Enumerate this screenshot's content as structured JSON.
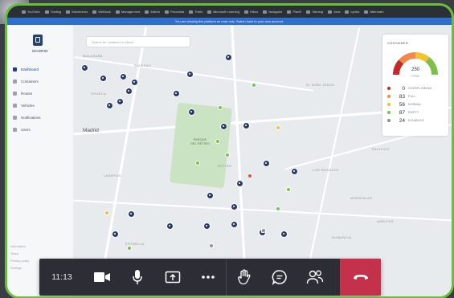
{
  "browser": {
    "tabs": [
      "YouTube",
      "Trading",
      "Waveforms",
      "WeBlock",
      "Management",
      "Airbnb",
      "Pavovista",
      "Trello",
      "Microsoft Learning",
      "Hibox",
      "Navigator",
      "PlanR",
      "Taiming",
      "Jobs",
      "Lydea",
      "Aftermath"
    ],
    "notice": "You are viewing this platform as read-only. Switch back to your own account."
  },
  "app": {
    "brand": "MADRID",
    "nav": [
      {
        "label": "Dashboard",
        "icon": "grid-icon"
      },
      {
        "label": "Containers",
        "icon": "container-icon"
      },
      {
        "label": "Routes",
        "icon": "route-icon"
      },
      {
        "label": "Vehicles",
        "icon": "truck-icon"
      },
      {
        "label": "Notifications",
        "icon": "bell-icon"
      },
      {
        "label": "Users",
        "icon": "users-icon"
      }
    ],
    "active_nav": 0,
    "footer": [
      "Information",
      "Terms",
      "Privacy policy",
      "Settings"
    ]
  },
  "map": {
    "search_placeholder": "Search for container or street",
    "labels": [
      {
        "text": "MALASAÑA",
        "big": false
      },
      {
        "text": "SALESAS",
        "big": false
      },
      {
        "text": "CHUECA",
        "big": false
      },
      {
        "text": "Madrid",
        "big": true
      },
      {
        "text": "RETIRO",
        "big": false
      },
      {
        "text": "LAVAPIES",
        "big": false
      },
      {
        "text": "ESTRELLA",
        "big": false
      },
      {
        "text": "MORATALAZ",
        "big": false
      },
      {
        "text": "ADELFAS",
        "big": false
      },
      {
        "text": "LOS ROSALES",
        "big": false
      },
      {
        "text": "NUMANCIA",
        "big": false
      },
      {
        "text": "PACIFICO",
        "big": false
      },
      {
        "text": "EL NIÑO JESUS",
        "big": false
      }
    ],
    "park_label_1": "PARQUE",
    "park_label_2": "DEL RETIRO",
    "pin_color": "#2c3a66"
  },
  "container_panel": {
    "title": "CONTAINER",
    "gauge_value": "250",
    "gauge_sub": "TOTAL",
    "legend": [
      {
        "count": "0",
        "label": "OVERFLOWING",
        "color": "#c62828"
      },
      {
        "count": "83",
        "label": "FULL",
        "color": "#ef8a4b"
      },
      {
        "count": "56",
        "label": "NORMAL",
        "color": "#f2c230"
      },
      {
        "count": "87",
        "label": "EMPTY",
        "color": "#7cbf4a"
      },
      {
        "count": "24",
        "label": "DISABLED",
        "color": "#8a8f98"
      }
    ]
  },
  "call": {
    "time": "11:13",
    "buttons": [
      {
        "icon": "camera-icon"
      },
      {
        "icon": "microphone-icon"
      },
      {
        "icon": "share-screen-icon"
      },
      {
        "icon": "more-options-icon"
      },
      {
        "icon": "raise-hand-icon"
      },
      {
        "icon": "chat-icon"
      },
      {
        "icon": "participants-icon"
      }
    ],
    "hangup_icon": "hang-up-icon",
    "hangup_color": "#c4314b"
  },
  "frame": {
    "accent": "#6abf3a"
  }
}
